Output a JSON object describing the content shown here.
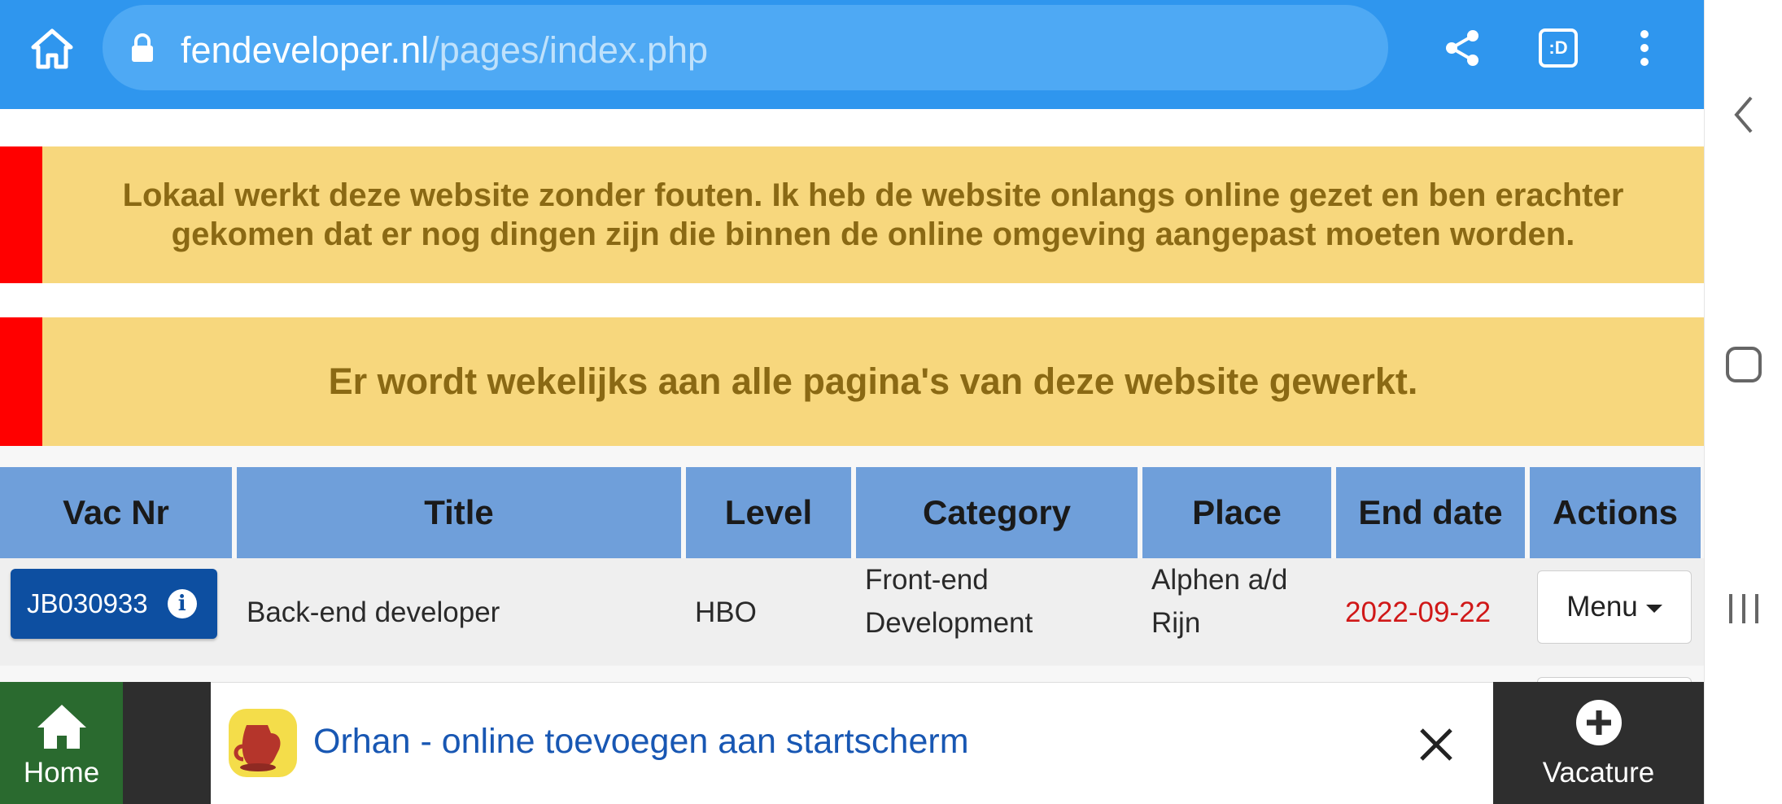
{
  "browser": {
    "url_domain": "fendeveloper.nl",
    "url_path": "/pages/index.php",
    "tab_icon_label": ":D"
  },
  "notices": [
    {
      "text": "Lokaal werkt deze website zonder fouten. Ik heb de website onlangs online gezet en ben erachter gekomen dat er nog dingen zijn die binnen de online omgeving aangepast moeten worden."
    },
    {
      "text": "Er wordt wekelijks aan alle pagina's van deze website gewerkt."
    }
  ],
  "table": {
    "headers": [
      "Vac Nr",
      "Title",
      "Level",
      "Category",
      "Place",
      "End date",
      "Actions"
    ],
    "rows": [
      {
        "vac_nr": "JB030933",
        "title": "Back-end developer",
        "level": "HBO",
        "category_line1": "Front-end",
        "category_line2": "Development",
        "place_line1": "Alphen a/d",
        "place_line2": "Rijn",
        "end_date": "2022-09-22",
        "action_label": "Menu"
      }
    ]
  },
  "bottom_bar": {
    "home_label": "Home",
    "vacature_label": "Vacature",
    "add_to_home_text": "Orhan - online toevoegen aan startscherm"
  },
  "colors": {
    "browser_bar": "#2f96ee",
    "notice_bg": "#f7d77d",
    "notice_accent": "#ff0000",
    "notice_text": "#8a6914",
    "table_header": "#6f9fda",
    "vac_button": "#0d4fa1",
    "end_date": "#d01818",
    "home_tab": "#2a6a2f"
  }
}
